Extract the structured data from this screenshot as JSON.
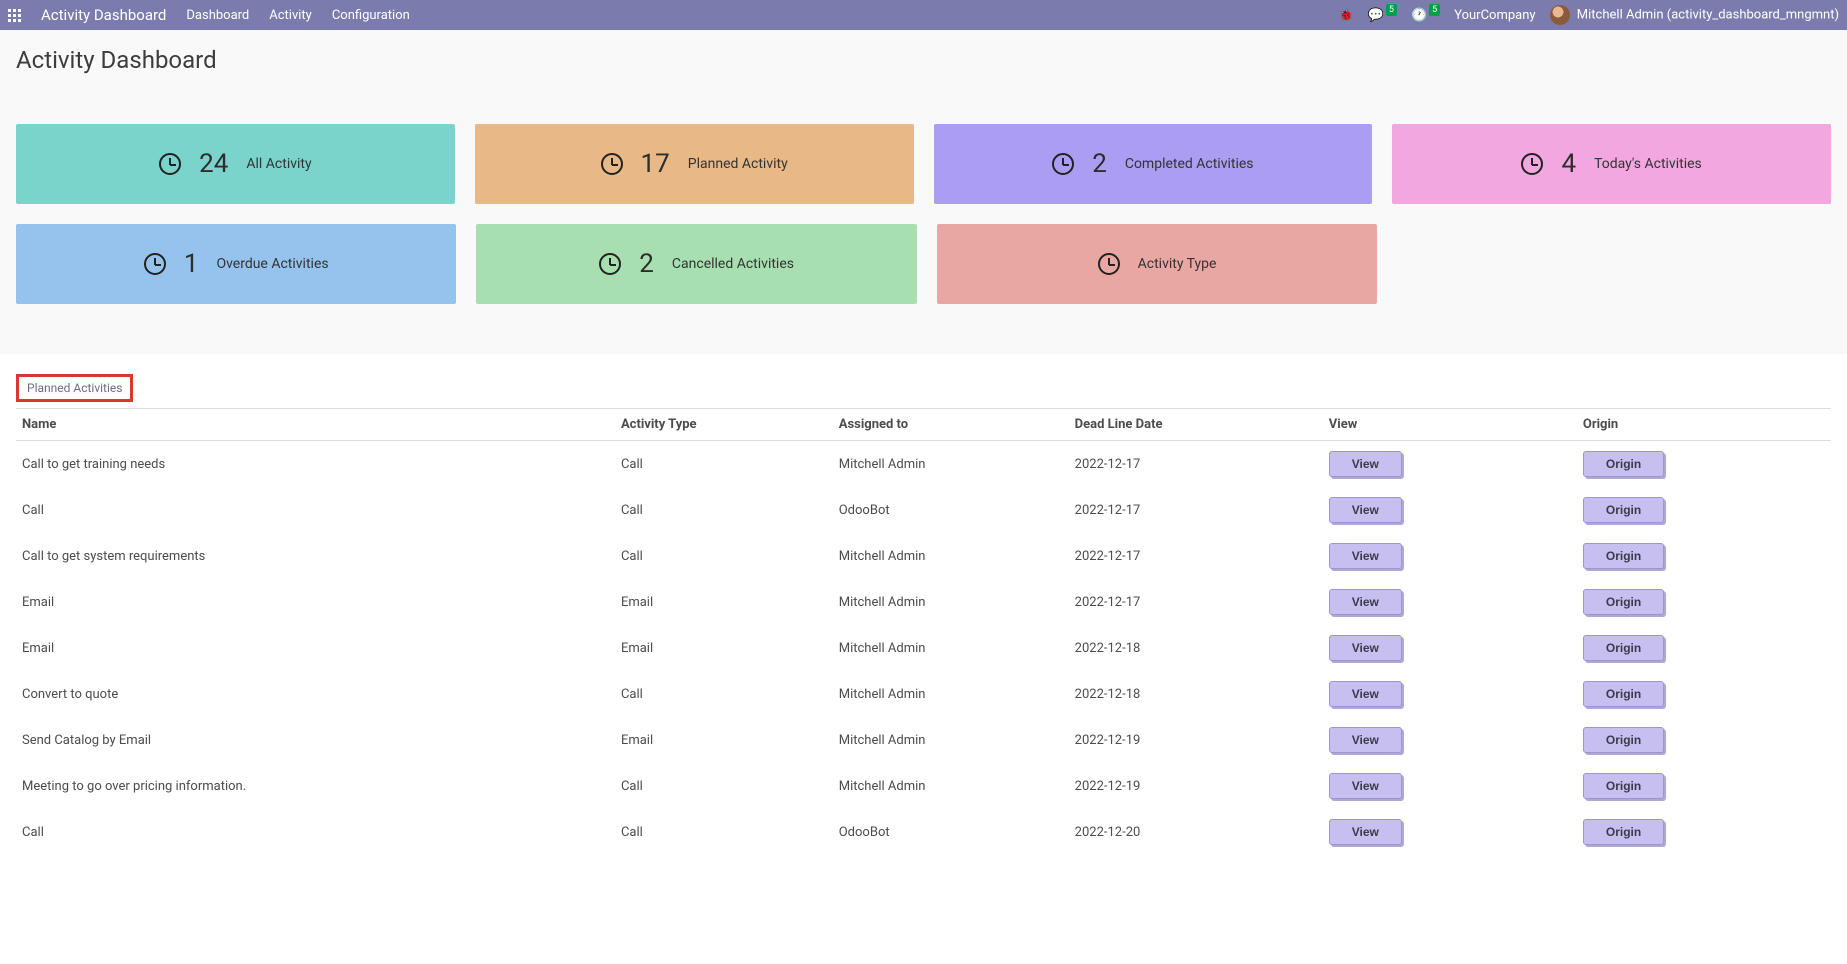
{
  "topbar": {
    "brand": "Activity Dashboard",
    "nav": [
      "Dashboard",
      "Activity",
      "Configuration"
    ],
    "chat_badge": "5",
    "clock_badge": "5",
    "company": "YourCompany",
    "user": "Mitchell Admin (activity_dashboard_mngmnt)"
  },
  "page": {
    "title": "Activity Dashboard"
  },
  "cards": [
    {
      "count": "24",
      "label": "All Activity"
    },
    {
      "count": "17",
      "label": "Planned Activity"
    },
    {
      "count": "2",
      "label": "Completed Activities"
    },
    {
      "count": "4",
      "label": "Today's Activities"
    },
    {
      "count": "1",
      "label": "Overdue Activities"
    },
    {
      "count": "2",
      "label": "Cancelled Activities"
    },
    {
      "count": "",
      "label": "Activity Type"
    }
  ],
  "tab": {
    "label": "Planned Activities"
  },
  "table": {
    "columns": [
      "Name",
      "Activity Type",
      "Assigned to",
      "Dead Line Date",
      "View",
      "Origin"
    ],
    "view_btn": "View",
    "origin_btn": "Origin",
    "rows": [
      {
        "name": "Call to get training needs",
        "type": "Call",
        "assigned": "Mitchell Admin",
        "date": "2022-12-17"
      },
      {
        "name": "Call",
        "type": "Call",
        "assigned": "OdooBot",
        "date": "2022-12-17"
      },
      {
        "name": "Call to get system requirements",
        "type": "Call",
        "assigned": "Mitchell Admin",
        "date": "2022-12-17"
      },
      {
        "name": "Email",
        "type": "Email",
        "assigned": "Mitchell Admin",
        "date": "2022-12-17"
      },
      {
        "name": "Email",
        "type": "Email",
        "assigned": "Mitchell Admin",
        "date": "2022-12-18"
      },
      {
        "name": "Convert to quote",
        "type": "Call",
        "assigned": "Mitchell Admin",
        "date": "2022-12-18"
      },
      {
        "name": "Send Catalog by Email",
        "type": "Email",
        "assigned": "Mitchell Admin",
        "date": "2022-12-19"
      },
      {
        "name": "Meeting to go over pricing information.",
        "type": "Call",
        "assigned": "Mitchell Admin",
        "date": "2022-12-19"
      },
      {
        "name": "Call",
        "type": "Call",
        "assigned": "OdooBot",
        "date": "2022-12-20"
      }
    ]
  }
}
